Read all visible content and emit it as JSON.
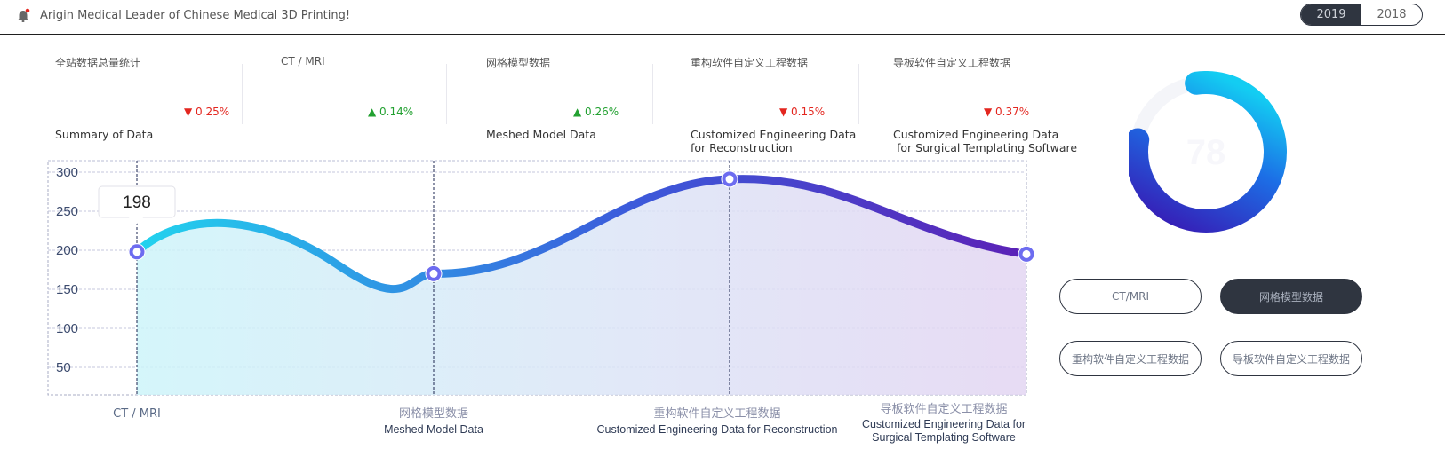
{
  "header": {
    "announcement": "Arigin Medical Leader of Chinese Medical 3D Printing!",
    "years": [
      {
        "label": "2019",
        "active": true
      },
      {
        "label": "2018",
        "active": false
      }
    ]
  },
  "stats": [
    {
      "title": "全站数据总量统计",
      "change": "0.25%",
      "direction": "down",
      "subtitle": "Summary of Data"
    },
    {
      "title": "CT / MRI",
      "change": "0.14%",
      "direction": "up",
      "subtitle": ""
    },
    {
      "title": "网格模型数据",
      "change": "0.26%",
      "direction": "up",
      "subtitle": "Meshed Model Data"
    },
    {
      "title": "重构软件自定义工程数据",
      "change": "0.15%",
      "direction": "down",
      "subtitle": "Customized Engineering Data\nfor Reconstruction"
    },
    {
      "title": "导板软件自定义工程数据",
      "change": "0.37%",
      "direction": "down",
      "subtitle": "Customized Engineering Data\n for Surgical Templating Software"
    }
  ],
  "colors": {
    "down": "#e3261f",
    "up": "#23a131",
    "line_start": "#22d3ee",
    "line_mid": "#3b5bdb",
    "line_end": "#5b21b6",
    "dark": "#2f3540"
  },
  "chart_data": {
    "type": "area",
    "categories": [
      "CT / MRI",
      "网格模型数据",
      "重构软件自定义工程数据",
      "导板软件自定义工程数据"
    ],
    "category_subtitles": [
      "",
      "Meshed Model Data",
      "Customized Engineering Data for Reconstruction",
      "Customized Engineering Data for\nSurgical Templating Software"
    ],
    "values": [
      198,
      170,
      291,
      195
    ],
    "yticks": [
      50,
      100,
      150,
      200,
      250,
      300
    ],
    "ylim": [
      0,
      300
    ],
    "tooltip": {
      "category": "CT / MRI",
      "value": "198"
    },
    "grid": true
  },
  "ring": {
    "value_text": "78"
  },
  "filters": [
    {
      "label": "CT/MRI",
      "active": false
    },
    {
      "label": "网格模型数据",
      "active": true
    },
    {
      "label": "重构软件自定义工程数据",
      "active": false
    },
    {
      "label": "导板软件自定义工程数据",
      "active": false
    }
  ]
}
